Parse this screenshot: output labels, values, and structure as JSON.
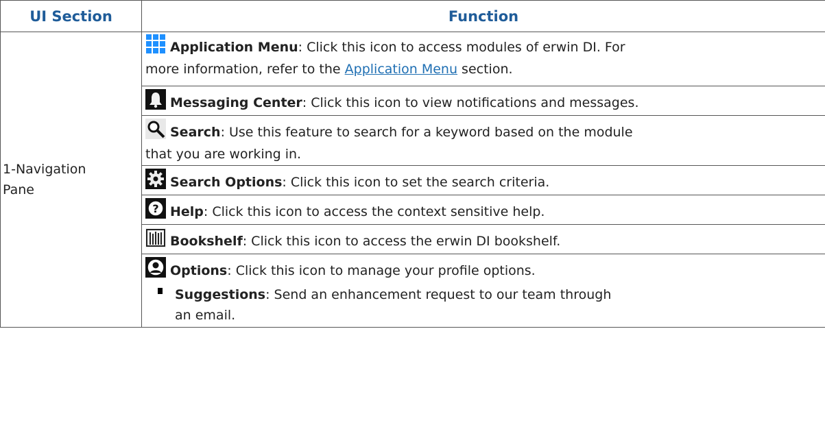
{
  "header": {
    "col1": "UI Section",
    "col2": "Function"
  },
  "section": {
    "line1": "1-Navigation",
    "line2": "Pane"
  },
  "rows": [
    {
      "icon": "grid-icon",
      "title": "Application Menu",
      "text1": ": Click this icon to access modules of erwin DI. For",
      "text2a": "more information, refer to the ",
      "link": "Application Menu",
      "text2b": " section."
    },
    {
      "icon": "bell-icon",
      "title": "Messaging Center",
      "text1": ": Click this icon to view notifications and messages."
    },
    {
      "icon": "search-icon",
      "title": "Search",
      "text1": ": Use this feature to search for a keyword based on the module",
      "text2": "that you are working in."
    },
    {
      "icon": "gear-icon",
      "title": "Search Options",
      "text1": ": Click this icon to set the search criteria."
    },
    {
      "icon": "help-icon",
      "title": "Help",
      "text1": ": Click this icon to access the context sensitive help."
    },
    {
      "icon": "bookshelf-icon",
      "title": "Bookshelf",
      "text1": ": Click this icon to access the erwin DI bookshelf."
    },
    {
      "icon": "user-icon",
      "title": "Options",
      "text1": ": Click this icon to manage your profile options."
    }
  ],
  "sub": {
    "title": "Suggestions",
    "text1": ": Send an enhancement request to our team through",
    "text2": "an email."
  },
  "colors": {
    "header": "#1f5c99",
    "link": "#1f6fb3",
    "grid_icon": "#1e90ff"
  }
}
